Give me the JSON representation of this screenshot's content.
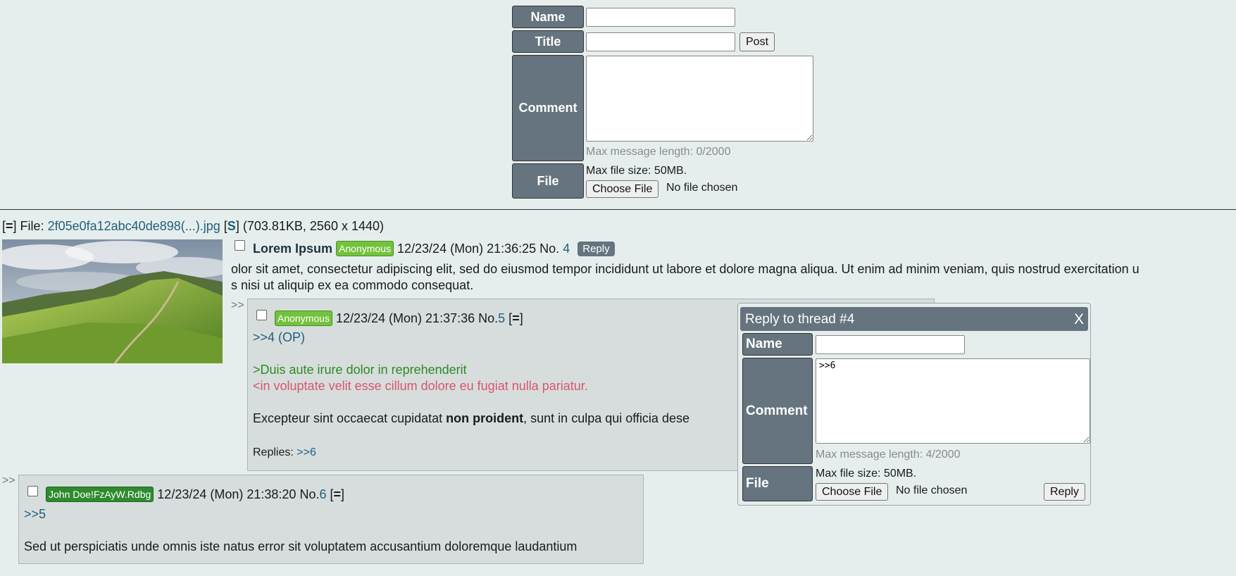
{
  "post_form": {
    "name_label": "Name",
    "title_label": "Title",
    "comment_label": "Comment",
    "file_label": "File",
    "post_button": "Post",
    "max_message": "Max message length: 0/2000",
    "max_file_size": "Max file size: 50MB.",
    "choose_file": "Choose File",
    "no_file": "No file chosen"
  },
  "op": {
    "file_open": "[",
    "file_toggle": "=",
    "file_close": "] File:",
    "file_name": "2f05e0fa12abc40de898(...).jpg",
    "s_open": "[",
    "s_link": "S",
    "s_close": "]",
    "file_meta": "(703.81KB, 2560 x 1440)",
    "subject": "Lorem Ipsum",
    "author": "Anonymous",
    "date": "12/23/24 (Mon) 21:36:25",
    "no_label": "No.",
    "no": "4",
    "reply_button": "Reply",
    "body_line1": "olor sit amet, consectetur adipiscing elit, sed do eiusmod tempor incididunt ut labore et dolore magna aliqua. Ut enim ad minim veniam, quis nostrud exercitation u",
    "body_line2": "s nisi ut aliquip ex ea commodo consequat."
  },
  "reply5": {
    "arrow": ">>",
    "author": "Anonymous",
    "date": "12/23/24 (Mon) 21:37:36",
    "no_label": "No.",
    "no": "5",
    "menu_open": "[",
    "menu": "=",
    "menu_close": "]",
    "quote_link": ">>4 (OP)",
    "greentext": ">Duis aute irure dolor in reprehenderit",
    "pinktext": "<in voluptate velit esse cillum dolore eu fugiat nulla pariatur.",
    "body_pre": "Excepteur sint occaecat cupidatat ",
    "body_bold": "non proident",
    "body_post": ", sunt in culpa qui officia dese",
    "replies_label": "Replies:",
    "replies_link": ">>6"
  },
  "reply6": {
    "arrow": ">>",
    "author": "John Doe!FzAyW.Rdbg",
    "date": "12/23/24 (Mon) 21:38:20",
    "no_label": "No.",
    "no": "6",
    "menu_open": "[",
    "menu": "=",
    "menu_close": "]",
    "quote_link": ">>5",
    "body": "Sed ut perspiciatis unde omnis iste natus error sit voluptatem accusantium doloremque laudantium"
  },
  "quick_reply": {
    "title": "Reply to thread #4",
    "close": "X",
    "name_label": "Name",
    "comment_label": "Comment",
    "comment_value": ">>6",
    "file_label": "File",
    "max_message": "Max message length: 4/2000",
    "max_file_size": "Max file size: 50MB.",
    "choose_file": "Choose File",
    "no_file": "No file chosen",
    "reply_button": "Reply"
  },
  "colors": {
    "background": "#e6eeed",
    "label_bg": "#65747e",
    "badge_green": "#73c23d",
    "badge_dark_green": "#2f8a2f",
    "greentext": "#2e8b23",
    "pinktext": "#d9566a",
    "link": "#1f5f7a"
  }
}
